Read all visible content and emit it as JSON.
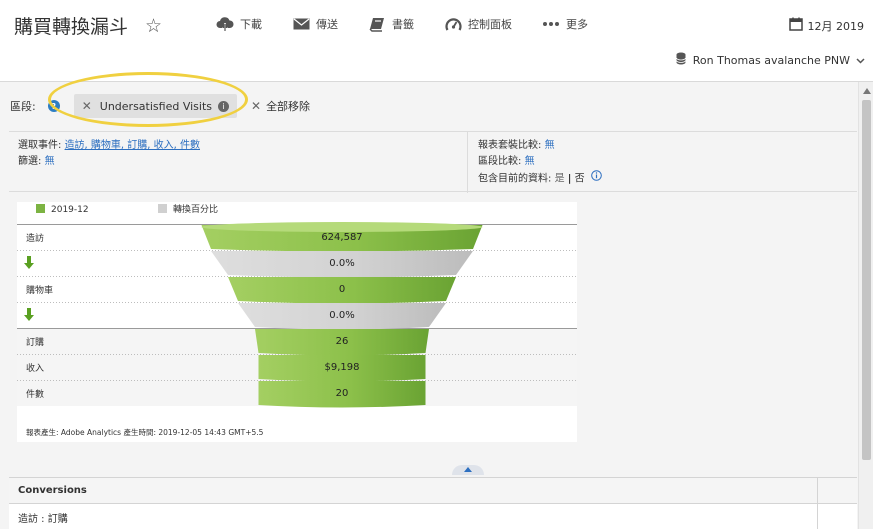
{
  "header": {
    "title": "購買轉換漏斗",
    "toolbar": [
      {
        "label": "下載",
        "icon": "cloud-download-icon"
      },
      {
        "label": "傳送",
        "icon": "envelope-icon"
      },
      {
        "label": "書籤",
        "icon": "bookmark-icon"
      },
      {
        "label": "控制面板",
        "icon": "dashboard-gauge-icon"
      },
      {
        "label": "更多",
        "icon": "more-dots-icon"
      }
    ],
    "date": "12月 2019",
    "report_suite": "Ron Thomas avalanche PNW"
  },
  "segments": {
    "label": "區段:",
    "chip": "Undersatisfied Visits",
    "remove_all": "全部移除"
  },
  "info": {
    "events_label": "選取事件:",
    "events_value": "造訪, 購物車, 訂購, 收入, 件數",
    "filter_label": "篩選:",
    "filter_value": "無",
    "suite_compare_label": "報表套裝比較:",
    "suite_compare_value": "無",
    "segment_compare_label": "區段比較:",
    "segment_compare_value": "無",
    "include_current_label": "包含目前的資料:",
    "include_yes": "是",
    "include_sep": "|",
    "include_no": "否"
  },
  "chart_data": {
    "type": "funnel",
    "legend": [
      {
        "name": "2019-12",
        "color": "#7cb342"
      },
      {
        "name": "轉換百分比",
        "color": "#d0d0d0"
      }
    ],
    "rows": [
      {
        "kind": "event",
        "label": "造訪",
        "value": "624,587"
      },
      {
        "kind": "conversion",
        "label": "",
        "value": "0.0%"
      },
      {
        "kind": "event",
        "label": "購物車",
        "value": "0"
      },
      {
        "kind": "conversion",
        "label": "",
        "value": "0.0%"
      },
      {
        "kind": "event",
        "label": "訂購",
        "value": "26"
      },
      {
        "kind": "event",
        "label": "收入",
        "value": "$9,198"
      },
      {
        "kind": "event",
        "label": "件數",
        "value": "20"
      }
    ],
    "footer": "報表產生: Adobe Analytics 產生時間: 2019-12-05 14:43 GMT+5.5"
  },
  "conversions": {
    "header": "Conversions",
    "row": "造訪 : 訂購"
  }
}
